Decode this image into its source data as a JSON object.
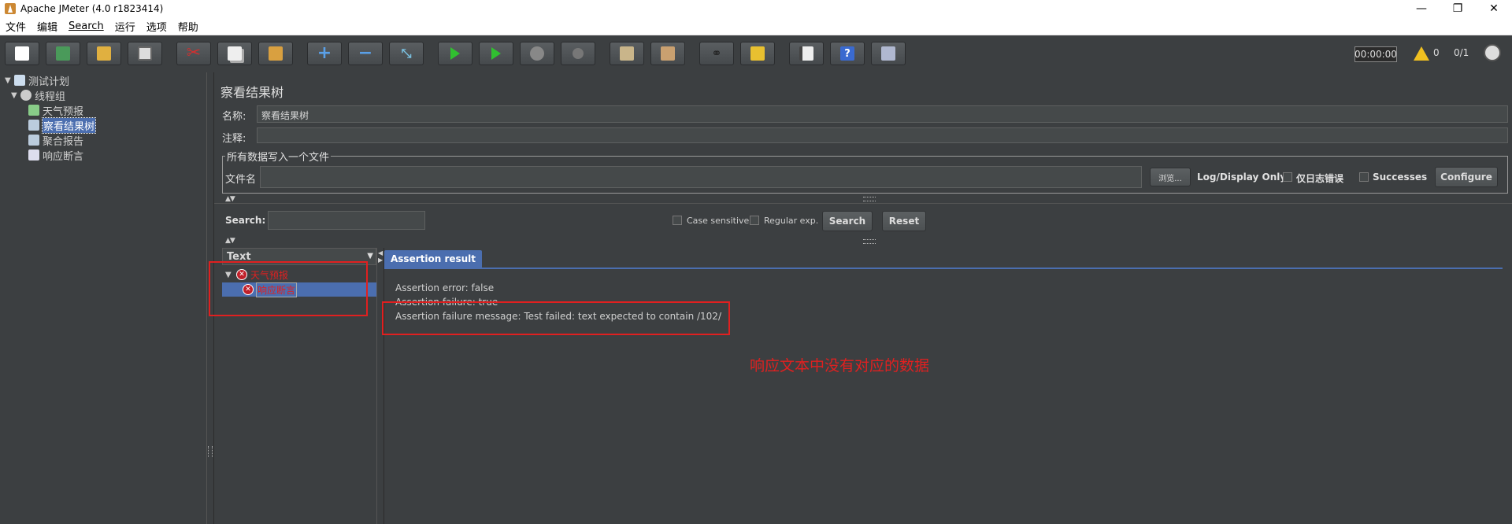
{
  "window": {
    "title": "Apache JMeter (4.0 r1823414)",
    "minimize": "—",
    "restore": "❐",
    "close": "✕"
  },
  "menu": [
    "文件",
    "编辑",
    "Search",
    "运行",
    "选项",
    "帮助"
  ],
  "toolbar": {
    "timer": "00:00:00",
    "warning_count": "0",
    "threads": "0/1"
  },
  "tree": {
    "root": "测试计划",
    "thread_group": "线程组",
    "items": [
      "天气预报",
      "察看结果树",
      "聚合报告",
      "响应断言"
    ]
  },
  "panel": {
    "title": "察看结果树",
    "name_label": "名称:",
    "name_value": "察看结果树",
    "comment_label": "注释:",
    "group_title": "所有数据写入一个文件",
    "filename_label": "文件名",
    "browse_label": "浏览...",
    "log_display_label": "Log/Display Only:",
    "errors_label": "仅日志错误",
    "successes_label": "Successes",
    "configure_label": "Configure",
    "search_label": "Search:",
    "case_sensitive_label": "Case sensitive",
    "regex_label": "Regular exp.",
    "search_button": "Search",
    "reset_button": "Reset"
  },
  "result_tree": {
    "header": "Text",
    "nodes": [
      "天气预报",
      "响应断言"
    ]
  },
  "assertion": {
    "tab_label": "Assertion result",
    "lines": [
      "Assertion error: false",
      "Assertion failure: true",
      "Assertion failure message: Test failed: text expected to contain /102/"
    ]
  },
  "annotation": {
    "note": "响应文本中没有对应的数据"
  },
  "colors": {
    "background": "#3c3f41",
    "selection": "#4b6eaf",
    "error_red": "#e02020"
  }
}
